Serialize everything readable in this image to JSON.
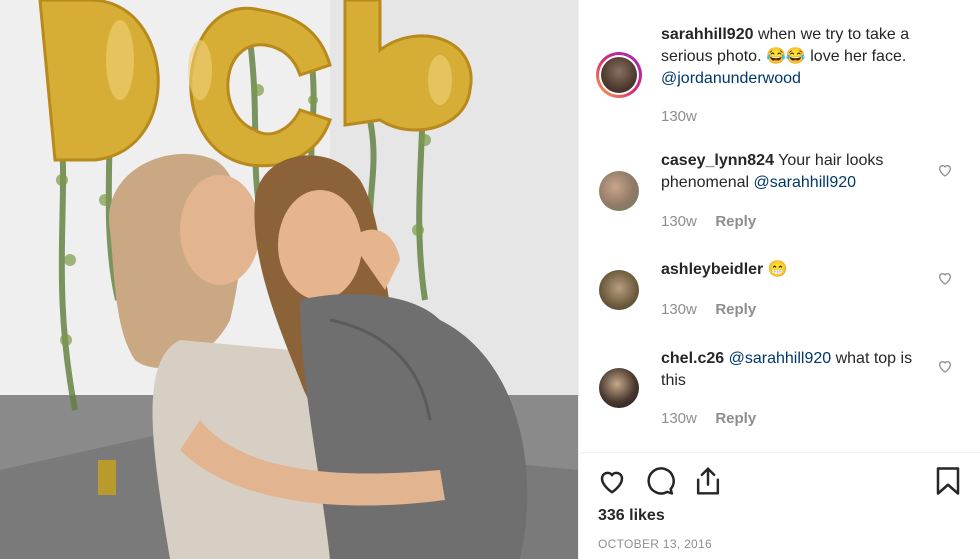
{
  "post": {
    "photo_alt": "",
    "author": {
      "username": "sarahhill920",
      "caption_text": "when we try to take a serious photo. 😂😂 love her face.",
      "mention": "@jordanunderwood",
      "time": "130w"
    },
    "comments": [
      {
        "username": "casey_lynn824",
        "text": "Your hair looks phenomenal",
        "mention": "@sarahhill920",
        "time": "130w",
        "reply_label": "Reply"
      },
      {
        "username": "ashleybeidler",
        "text": "😁",
        "mention": "",
        "time": "130w",
        "reply_label": "Reply"
      },
      {
        "username": "chel.c26",
        "text": "what top is this",
        "mention": "@sarahhill920",
        "time": "130w",
        "reply_label": "Reply"
      }
    ],
    "actions": {
      "like_icon": "heart-icon",
      "comment_icon": "comment-bubble-icon",
      "share_icon": "share-icon",
      "save_icon": "bookmark-icon"
    },
    "likes_text": "336 likes",
    "date": "OCTOBER 13, 2016"
  }
}
